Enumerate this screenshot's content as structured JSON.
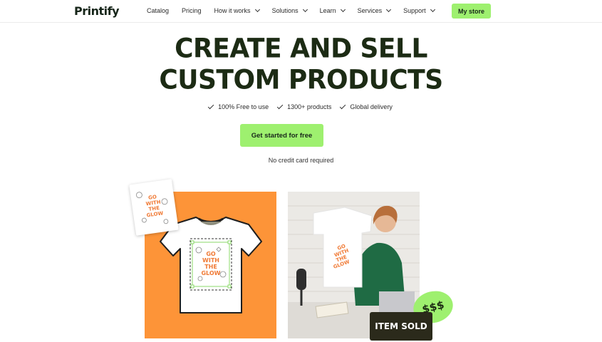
{
  "nav": {
    "logo": "Printify",
    "links": [
      {
        "label": "Catalog",
        "dropdown": false
      },
      {
        "label": "Pricing",
        "dropdown": false
      },
      {
        "label": "How it works",
        "dropdown": true
      },
      {
        "label": "Solutions",
        "dropdown": true
      },
      {
        "label": "Learn",
        "dropdown": true
      },
      {
        "label": "Services",
        "dropdown": true
      },
      {
        "label": "Support",
        "dropdown": true
      }
    ],
    "cta": "My store"
  },
  "hero": {
    "title_line1": "CREATE AND SELL",
    "title_line2": "CUSTOM PRODUCTS",
    "features": [
      "100% Free to use",
      "1300+ products",
      "Global delivery"
    ],
    "cta": "Get started for free",
    "note": "No credit card required"
  },
  "visuals": {
    "design_text": "GO WITH THE GLOW",
    "badge_sold": "ITEM SOLD",
    "badge_money": "$$$",
    "colors": {
      "accent_green": "#9ef06f",
      "orange": "#fd9438",
      "dark": "#1c2b14",
      "design_orange": "#f07a35"
    }
  }
}
